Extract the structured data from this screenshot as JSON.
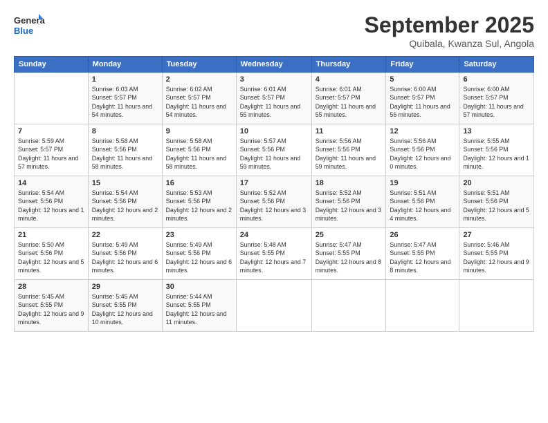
{
  "logo": {
    "line1": "General",
    "line2": "Blue"
  },
  "title": "September 2025",
  "subtitle": "Quibala, Kwanza Sul, Angola",
  "headers": [
    "Sunday",
    "Monday",
    "Tuesday",
    "Wednesday",
    "Thursday",
    "Friday",
    "Saturday"
  ],
  "weeks": [
    [
      {
        "day": "",
        "sunrise": "",
        "sunset": "",
        "daylight": ""
      },
      {
        "day": "1",
        "sunrise": "Sunrise: 6:03 AM",
        "sunset": "Sunset: 5:57 PM",
        "daylight": "Daylight: 11 hours and 54 minutes."
      },
      {
        "day": "2",
        "sunrise": "Sunrise: 6:02 AM",
        "sunset": "Sunset: 5:57 PM",
        "daylight": "Daylight: 11 hours and 54 minutes."
      },
      {
        "day": "3",
        "sunrise": "Sunrise: 6:01 AM",
        "sunset": "Sunset: 5:57 PM",
        "daylight": "Daylight: 11 hours and 55 minutes."
      },
      {
        "day": "4",
        "sunrise": "Sunrise: 6:01 AM",
        "sunset": "Sunset: 5:57 PM",
        "daylight": "Daylight: 11 hours and 55 minutes."
      },
      {
        "day": "5",
        "sunrise": "Sunrise: 6:00 AM",
        "sunset": "Sunset: 5:57 PM",
        "daylight": "Daylight: 11 hours and 56 minutes."
      },
      {
        "day": "6",
        "sunrise": "Sunrise: 6:00 AM",
        "sunset": "Sunset: 5:57 PM",
        "daylight": "Daylight: 11 hours and 57 minutes."
      }
    ],
    [
      {
        "day": "7",
        "sunrise": "Sunrise: 5:59 AM",
        "sunset": "Sunset: 5:57 PM",
        "daylight": "Daylight: 11 hours and 57 minutes."
      },
      {
        "day": "8",
        "sunrise": "Sunrise: 5:58 AM",
        "sunset": "Sunset: 5:56 PM",
        "daylight": "Daylight: 11 hours and 58 minutes."
      },
      {
        "day": "9",
        "sunrise": "Sunrise: 5:58 AM",
        "sunset": "Sunset: 5:56 PM",
        "daylight": "Daylight: 11 hours and 58 minutes."
      },
      {
        "day": "10",
        "sunrise": "Sunrise: 5:57 AM",
        "sunset": "Sunset: 5:56 PM",
        "daylight": "Daylight: 11 hours and 59 minutes."
      },
      {
        "day": "11",
        "sunrise": "Sunrise: 5:56 AM",
        "sunset": "Sunset: 5:56 PM",
        "daylight": "Daylight: 11 hours and 59 minutes."
      },
      {
        "day": "12",
        "sunrise": "Sunrise: 5:56 AM",
        "sunset": "Sunset: 5:56 PM",
        "daylight": "Daylight: 12 hours and 0 minutes."
      },
      {
        "day": "13",
        "sunrise": "Sunrise: 5:55 AM",
        "sunset": "Sunset: 5:56 PM",
        "daylight": "Daylight: 12 hours and 1 minute."
      }
    ],
    [
      {
        "day": "14",
        "sunrise": "Sunrise: 5:54 AM",
        "sunset": "Sunset: 5:56 PM",
        "daylight": "Daylight: 12 hours and 1 minute."
      },
      {
        "day": "15",
        "sunrise": "Sunrise: 5:54 AM",
        "sunset": "Sunset: 5:56 PM",
        "daylight": "Daylight: 12 hours and 2 minutes."
      },
      {
        "day": "16",
        "sunrise": "Sunrise: 5:53 AM",
        "sunset": "Sunset: 5:56 PM",
        "daylight": "Daylight: 12 hours and 2 minutes."
      },
      {
        "day": "17",
        "sunrise": "Sunrise: 5:52 AM",
        "sunset": "Sunset: 5:56 PM",
        "daylight": "Daylight: 12 hours and 3 minutes."
      },
      {
        "day": "18",
        "sunrise": "Sunrise: 5:52 AM",
        "sunset": "Sunset: 5:56 PM",
        "daylight": "Daylight: 12 hours and 3 minutes."
      },
      {
        "day": "19",
        "sunrise": "Sunrise: 5:51 AM",
        "sunset": "Sunset: 5:56 PM",
        "daylight": "Daylight: 12 hours and 4 minutes."
      },
      {
        "day": "20",
        "sunrise": "Sunrise: 5:51 AM",
        "sunset": "Sunset: 5:56 PM",
        "daylight": "Daylight: 12 hours and 5 minutes."
      }
    ],
    [
      {
        "day": "21",
        "sunrise": "Sunrise: 5:50 AM",
        "sunset": "Sunset: 5:56 PM",
        "daylight": "Daylight: 12 hours and 5 minutes."
      },
      {
        "day": "22",
        "sunrise": "Sunrise: 5:49 AM",
        "sunset": "Sunset: 5:56 PM",
        "daylight": "Daylight: 12 hours and 6 minutes."
      },
      {
        "day": "23",
        "sunrise": "Sunrise: 5:49 AM",
        "sunset": "Sunset: 5:56 PM",
        "daylight": "Daylight: 12 hours and 6 minutes."
      },
      {
        "day": "24",
        "sunrise": "Sunrise: 5:48 AM",
        "sunset": "Sunset: 5:55 PM",
        "daylight": "Daylight: 12 hours and 7 minutes."
      },
      {
        "day": "25",
        "sunrise": "Sunrise: 5:47 AM",
        "sunset": "Sunset: 5:55 PM",
        "daylight": "Daylight: 12 hours and 8 minutes."
      },
      {
        "day": "26",
        "sunrise": "Sunrise: 5:47 AM",
        "sunset": "Sunset: 5:55 PM",
        "daylight": "Daylight: 12 hours and 8 minutes."
      },
      {
        "day": "27",
        "sunrise": "Sunrise: 5:46 AM",
        "sunset": "Sunset: 5:55 PM",
        "daylight": "Daylight: 12 hours and 9 minutes."
      }
    ],
    [
      {
        "day": "28",
        "sunrise": "Sunrise: 5:45 AM",
        "sunset": "Sunset: 5:55 PM",
        "daylight": "Daylight: 12 hours and 9 minutes."
      },
      {
        "day": "29",
        "sunrise": "Sunrise: 5:45 AM",
        "sunset": "Sunset: 5:55 PM",
        "daylight": "Daylight: 12 hours and 10 minutes."
      },
      {
        "day": "30",
        "sunrise": "Sunrise: 5:44 AM",
        "sunset": "Sunset: 5:55 PM",
        "daylight": "Daylight: 12 hours and 11 minutes."
      },
      {
        "day": "",
        "sunrise": "",
        "sunset": "",
        "daylight": ""
      },
      {
        "day": "",
        "sunrise": "",
        "sunset": "",
        "daylight": ""
      },
      {
        "day": "",
        "sunrise": "",
        "sunset": "",
        "daylight": ""
      },
      {
        "day": "",
        "sunrise": "",
        "sunset": "",
        "daylight": ""
      }
    ]
  ]
}
